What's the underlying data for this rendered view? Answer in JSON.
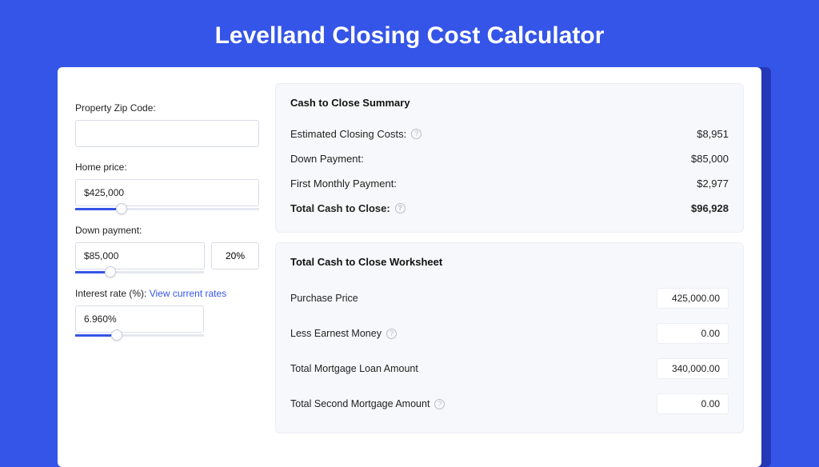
{
  "page_title": "Levelland Closing Cost Calculator",
  "left": {
    "zip_label": "Property Zip Code:",
    "zip_value": "",
    "home_price_label": "Home price:",
    "home_price_value": "$425,000",
    "home_price_slider_pct": 22,
    "down_payment_label": "Down payment:",
    "down_payment_value": "$85,000",
    "down_payment_pct": "20%",
    "down_payment_slider_pct": 23,
    "interest_label": "Interest rate (%): ",
    "interest_link": "View current rates",
    "interest_value": "6.960%",
    "interest_slider_pct": 28
  },
  "summary": {
    "title": "Cash to Close Summary",
    "rows": [
      {
        "label": "Estimated Closing Costs:",
        "help": true,
        "value": "$8,951",
        "bold": false
      },
      {
        "label": "Down Payment:",
        "help": false,
        "value": "$85,000",
        "bold": false
      },
      {
        "label": "First Monthly Payment:",
        "help": false,
        "value": "$2,977",
        "bold": false
      },
      {
        "label": "Total Cash to Close:",
        "help": true,
        "value": "$96,928",
        "bold": true
      }
    ]
  },
  "worksheet": {
    "title": "Total Cash to Close Worksheet",
    "rows": [
      {
        "label": "Purchase Price",
        "help": false,
        "value": "425,000.00"
      },
      {
        "label": "Less Earnest Money",
        "help": true,
        "value": "0.00"
      },
      {
        "label": "Total Mortgage Loan Amount",
        "help": false,
        "value": "340,000.00"
      },
      {
        "label": "Total Second Mortgage Amount",
        "help": true,
        "value": "0.00"
      }
    ]
  }
}
